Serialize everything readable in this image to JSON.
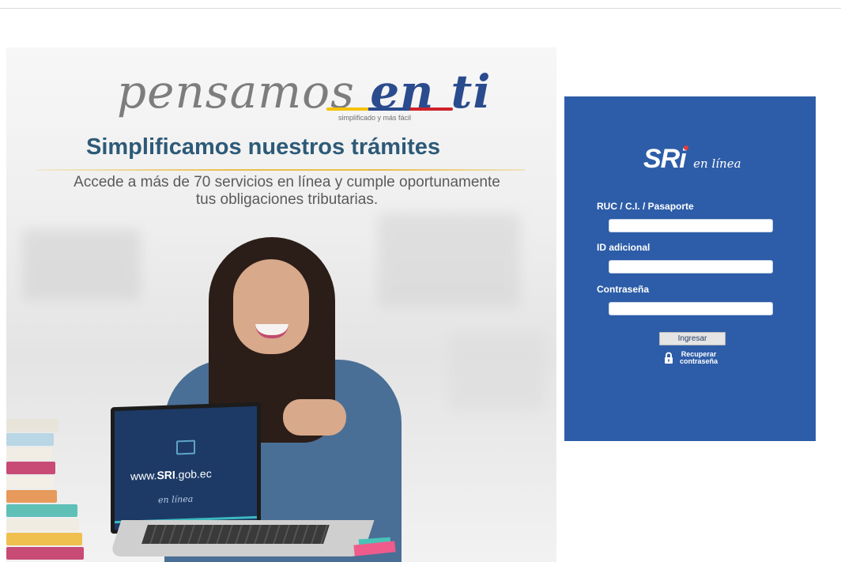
{
  "banner": {
    "slogan_light": "pensamos",
    "slogan_strong": "en ti",
    "slogan_sub": "simplificado y más fácil",
    "headline": "Simplificamos nuestros trámites",
    "subhead_line1": "Accede a más de 70 servicios en línea y cumple oportunamente",
    "subhead_line2": "tus obligaciones tributarias.",
    "laptop_url_prefix": "www.",
    "laptop_url_brand": "SRI",
    "laptop_url_suffix": ".gob.ec",
    "laptop_script": "en línea"
  },
  "login": {
    "logo_main": "SRi",
    "logo_sub": "en línea",
    "fields": [
      {
        "label": "RUC / C.I. / Pasaporte",
        "value": "",
        "placeholder": ""
      },
      {
        "label": "ID adicional",
        "value": "",
        "placeholder": ""
      },
      {
        "label": "Contraseña",
        "value": "",
        "placeholder": ""
      }
    ],
    "submit_label": "Ingresar",
    "recover_line1": "Recuperar",
    "recover_line2": "contraseña"
  },
  "colors": {
    "panel": "#2d5da8",
    "headline": "#2d5a78"
  },
  "icons": {
    "recover": "lock-icon",
    "laptop": "monitor-icon"
  }
}
